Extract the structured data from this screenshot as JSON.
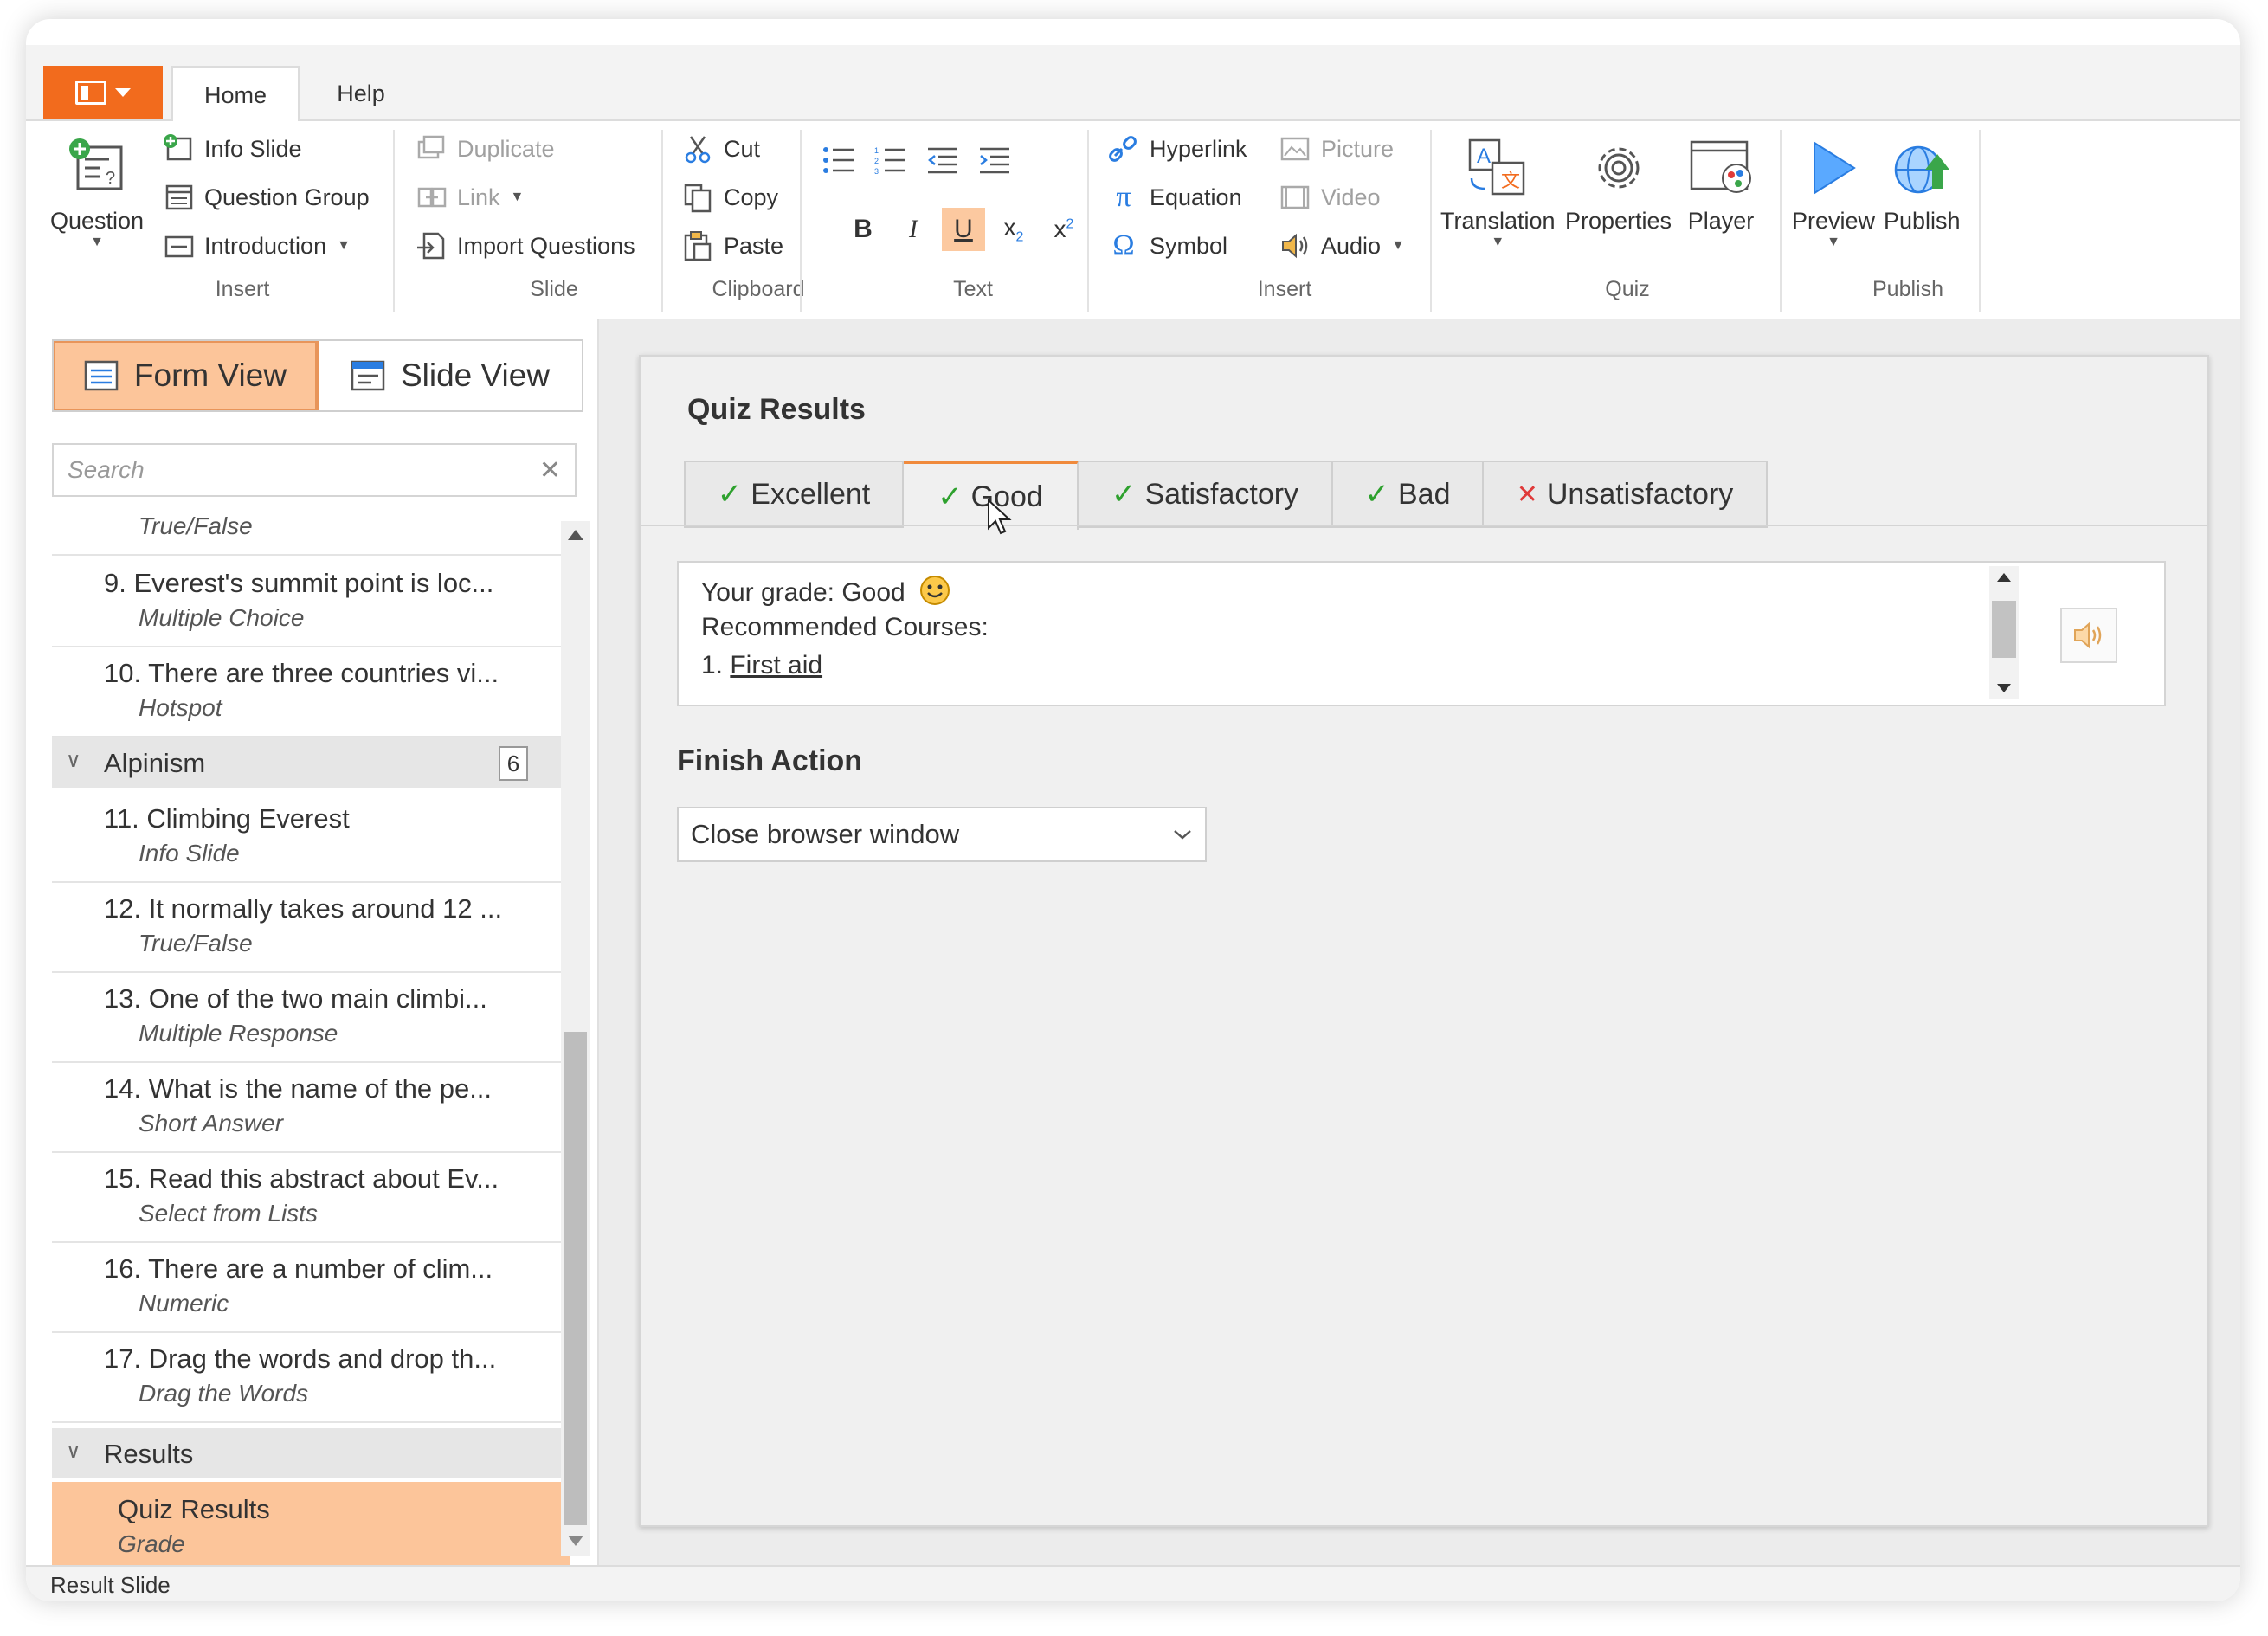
{
  "ribbon_tabs": [
    "Home",
    "Help"
  ],
  "insert_group": {
    "question": "Question",
    "info_slide": "Info Slide",
    "question_group": "Question Group",
    "introduction": "Introduction",
    "label": "Insert"
  },
  "slide_group": {
    "duplicate": "Duplicate",
    "link": "Link",
    "import_questions": "Import Questions",
    "label": "Slide"
  },
  "clipboard_group": {
    "cut": "Cut",
    "copy": "Copy",
    "paste": "Paste",
    "label": "Clipboard"
  },
  "text_group": {
    "bold": "B",
    "italic": "I",
    "underline": "U",
    "label": "Text"
  },
  "insert_group2": {
    "hyperlink": "Hyperlink",
    "equation": "Equation",
    "symbol": "Symbol",
    "picture": "Picture",
    "video": "Video",
    "audio": "Audio",
    "label": "Insert"
  },
  "quiz_group": {
    "translation": "Translation",
    "properties": "Properties",
    "player": "Player",
    "label": "Quiz"
  },
  "publish_group": {
    "preview": "Preview",
    "publish": "Publish",
    "label": "Publish"
  },
  "view_buttons": {
    "form_view": "Form View",
    "slide_view": "Slide View"
  },
  "search": {
    "placeholder": "Search"
  },
  "tree": {
    "partial_item_type": "True/False",
    "items_a": [
      {
        "title": "9.  Everest's summit point is loc...",
        "type": "Multiple Choice"
      },
      {
        "title": "10.  There are three countries vi...",
        "type": "Hotspot"
      }
    ],
    "group_alpinism": {
      "name": "Alpinism",
      "count": "6"
    },
    "items_b": [
      {
        "title": "11.  Climbing Everest",
        "type": "Info Slide"
      },
      {
        "title": "12.  It normally takes around 12 ...",
        "type": "True/False"
      },
      {
        "title": "13.  One of the two main climbi...",
        "type": "Multiple Response"
      },
      {
        "title": "14.  What is the name of the pe...",
        "type": "Short Answer"
      },
      {
        "title": "15.  Read this abstract about Ev...",
        "type": "Select from Lists"
      },
      {
        "title": "16.  There are a number of clim...",
        "type": "Numeric"
      },
      {
        "title": "17.  Drag the words and drop th...",
        "type": "Drag the Words"
      }
    ],
    "group_results": {
      "name": "Results"
    },
    "selected_item": {
      "title": "Quiz Results",
      "type": "Grade"
    }
  },
  "main": {
    "title": "Quiz Results",
    "grade_tabs": [
      {
        "label": "Excellent",
        "mark": "✓"
      },
      {
        "label": "Good",
        "mark": "✓"
      },
      {
        "label": "Satisfactory",
        "mark": "✓"
      },
      {
        "label": "Bad",
        "mark": "✓"
      },
      {
        "label": "Unsatisfactory",
        "mark": "✕"
      }
    ],
    "editor": {
      "line1": "Your grade: Good",
      "line2": "Recommended Courses:",
      "line3_num": "1. ",
      "line3_link": "First aid"
    },
    "finish_action_label": "Finish Action",
    "finish_action_value": "Close browser window"
  },
  "status_bar": "Result Slide",
  "colors": {
    "accent_orange": "#f26b1d",
    "selection_peach": "#fcc59a",
    "check_green": "#2ea12e",
    "cross_red": "#e03a3a"
  }
}
